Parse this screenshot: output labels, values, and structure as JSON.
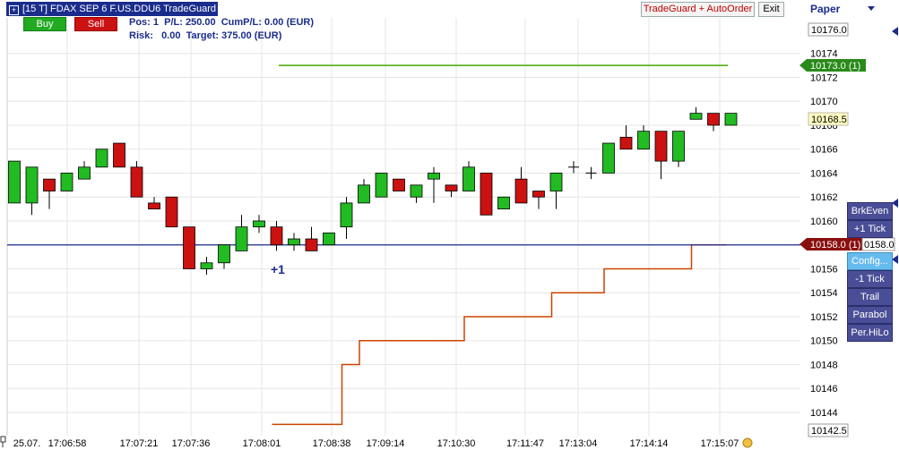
{
  "window": {
    "title": "[15 T] FDAX SEP 6   F.US.DDU6 TradeGuard",
    "mode": "Paper"
  },
  "order_buttons": {
    "buy": "Buy",
    "sell": "Sell"
  },
  "position": {
    "line1": "Pos: 1  P/L: 250.00  CumP/L: 0.00 (EUR)",
    "line2": "Risk:   0.00  Target: 375.00 (EUR)"
  },
  "toolbar": {
    "tradeguard": "TradeGuard + AutoOrder",
    "exit": "Exit"
  },
  "side_panel": {
    "buttons": [
      "BrkEven",
      "+1 Tick",
      "Config...",
      "-1 Tick",
      "Trail",
      "Parabol",
      "Per.HiLo"
    ]
  },
  "markers": {
    "fill_label": "+1",
    "price_top": "10176.0",
    "price_bottom": "10142.5",
    "target_label": "10173.0 (1)",
    "last_price": "10168.5",
    "entry_label": "10158.0 (1)",
    "entry_label_right": "0158.0"
  },
  "colors": {
    "up": "#22bb22",
    "down": "#cc1111",
    "target": "#44aa00",
    "entry": "#1a2c8c",
    "stop": "#cc4400"
  },
  "chart_data": {
    "type": "candlestick",
    "y_ticks": [
      10174,
      10172,
      10170,
      10168,
      10166,
      10164,
      10162,
      10160,
      10158,
      10156,
      10154,
      10152,
      10150,
      10148,
      10146,
      10144
    ],
    "x_tick_labels": [
      "25.07.",
      "17:06:58",
      "17:07:21",
      "17:07:36",
      "17:08:01",
      "17:08:38",
      "17:09:14",
      "17:10:30",
      "17:11:47",
      "17:13:04",
      "17:14:14",
      "17:15:07"
    ],
    "ylim": [
      10142.5,
      10176.0
    ],
    "candles": [
      {
        "o": 10161.5,
        "h": 10165.0,
        "l": 10161.5,
        "c": 10165.0
      },
      {
        "o": 10161.5,
        "h": 10164.5,
        "l": 10160.5,
        "c": 10164.5
      },
      {
        "o": 10163.5,
        "h": 10163.5,
        "l": 10161.0,
        "c": 10162.5
      },
      {
        "o": 10162.5,
        "h": 10164.0,
        "l": 10162.5,
        "c": 10164.0
      },
      {
        "o": 10163.5,
        "h": 10165.0,
        "l": 10163.5,
        "c": 10164.5
      },
      {
        "o": 10164.5,
        "h": 10166.0,
        "l": 10164.5,
        "c": 10166.0
      },
      {
        "o": 10166.5,
        "h": 10166.5,
        "l": 10164.5,
        "c": 10164.5
      },
      {
        "o": 10164.5,
        "h": 10165.0,
        "l": 10162.0,
        "c": 10162.0
      },
      {
        "o": 10161.5,
        "h": 10162.0,
        "l": 10161.0,
        "c": 10161.0
      },
      {
        "o": 10162.0,
        "h": 10162.0,
        "l": 10159.5,
        "c": 10159.5
      },
      {
        "o": 10159.5,
        "h": 10159.5,
        "l": 10156.0,
        "c": 10156.0
      },
      {
        "o": 10156.0,
        "h": 10157.0,
        "l": 10155.5,
        "c": 10156.5
      },
      {
        "o": 10156.5,
        "h": 10158.0,
        "l": 10156.0,
        "c": 10158.0
      },
      {
        "o": 10157.5,
        "h": 10160.5,
        "l": 10157.5,
        "c": 10159.5
      },
      {
        "o": 10159.5,
        "h": 10160.5,
        "l": 10159.0,
        "c": 10160.0
      },
      {
        "o": 10159.5,
        "h": 10160.0,
        "l": 10157.5,
        "c": 10158.0
      },
      {
        "o": 10158.0,
        "h": 10159.0,
        "l": 10157.5,
        "c": 10158.5
      },
      {
        "o": 10158.5,
        "h": 10159.5,
        "l": 10157.5,
        "c": 10157.5
      },
      {
        "o": 10158.0,
        "h": 10159.0,
        "l": 10158.0,
        "c": 10159.0
      },
      {
        "o": 10159.5,
        "h": 10162.0,
        "l": 10158.5,
        "c": 10161.5
      },
      {
        "o": 10161.5,
        "h": 10163.5,
        "l": 10161.5,
        "c": 10163.0
      },
      {
        "o": 10162.0,
        "h": 10164.0,
        "l": 10162.0,
        "c": 10164.0
      },
      {
        "o": 10163.5,
        "h": 10163.5,
        "l": 10162.5,
        "c": 10162.5
      },
      {
        "o": 10162.0,
        "h": 10163.0,
        "l": 10161.5,
        "c": 10163.0
      },
      {
        "o": 10163.5,
        "h": 10164.5,
        "l": 10161.5,
        "c": 10164.0
      },
      {
        "o": 10163.0,
        "h": 10163.0,
        "l": 10162.0,
        "c": 10162.5
      },
      {
        "o": 10162.5,
        "h": 10165.0,
        "l": 10162.5,
        "c": 10164.5
      },
      {
        "o": 10164.0,
        "h": 10164.0,
        "l": 10160.5,
        "c": 10160.5
      },
      {
        "o": 10161.0,
        "h": 10162.0,
        "l": 10161.0,
        "c": 10162.0
      },
      {
        "o": 10163.5,
        "h": 10164.5,
        "l": 10161.5,
        "c": 10161.5
      },
      {
        "o": 10162.5,
        "h": 10162.5,
        "l": 10161.0,
        "c": 10162.0
      },
      {
        "o": 10162.5,
        "h": 10164.0,
        "l": 10161.0,
        "c": 10164.0
      },
      {
        "o": 10164.5,
        "h": 10165.0,
        "l": 10164.0,
        "c": 10164.5
      },
      {
        "o": 10164.0,
        "h": 10164.5,
        "l": 10163.5,
        "c": 10164.0
      },
      {
        "o": 10164.0,
        "h": 10166.5,
        "l": 10164.0,
        "c": 10166.5
      },
      {
        "o": 10167.0,
        "h": 10168.0,
        "l": 10166.0,
        "c": 10166.0
      },
      {
        "o": 10166.0,
        "h": 10168.0,
        "l": 10166.0,
        "c": 10167.5
      },
      {
        "o": 10167.5,
        "h": 10167.5,
        "l": 10163.5,
        "c": 10165.0
      },
      {
        "o": 10165.0,
        "h": 10167.5,
        "l": 10164.5,
        "c": 10167.5
      },
      {
        "o": 10168.5,
        "h": 10169.5,
        "l": 10168.5,
        "c": 10169.0
      },
      {
        "o": 10169.0,
        "h": 10169.0,
        "l": 10167.5,
        "c": 10168.0
      },
      {
        "o": 10168.0,
        "h": 10169.0,
        "l": 10168.0,
        "c": 10169.0
      }
    ],
    "target_price": 10173.0,
    "entry_price": 10158.0,
    "stop_steps": [
      {
        "from_candle": 15,
        "to_candle": 19,
        "price": 10143.0
      },
      {
        "from_candle": 19,
        "to_candle": 20,
        "price": 10148.0
      },
      {
        "from_candle": 20,
        "to_candle": 26,
        "price": 10150.0
      },
      {
        "from_candle": 26,
        "to_candle": 31,
        "price": 10152.0
      },
      {
        "from_candle": 31,
        "to_candle": 34,
        "price": 10154.0
      },
      {
        "from_candle": 34,
        "to_candle": 39,
        "price": 10156.0
      },
      {
        "from_candle": 39,
        "to_candle": 41,
        "price": 10158.0
      }
    ]
  }
}
